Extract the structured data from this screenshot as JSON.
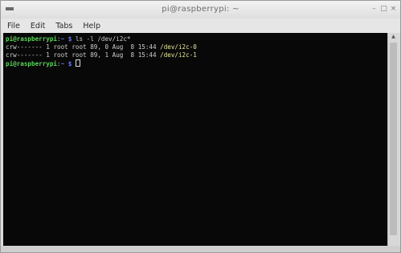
{
  "window": {
    "title": "pi@raspberrypi: ~",
    "controls": [
      "–",
      "□",
      "×"
    ]
  },
  "menu": {
    "items": [
      "File",
      "Edit",
      "Tabs",
      "Help"
    ]
  },
  "terminal": {
    "prompt_user": "pi@raspberrypi",
    "prompt_path": "~",
    "prompt_symbol": "$",
    "command": "ls -l /dev/i2c*",
    "lines": [
      {
        "perms": "crw-------",
        "links": "1",
        "owner": "root",
        "group": "root",
        "major": "89,",
        "minor": "0",
        "month": "Aug",
        "day": "8",
        "time": "15:44",
        "path": "/dev/i2c-0"
      },
      {
        "perms": "crw-------",
        "links": "1",
        "owner": "root",
        "group": "root",
        "major": "89,",
        "minor": "1",
        "month": "Aug",
        "day": "8",
        "time": "15:44",
        "path": "/dev/i2c-1"
      }
    ]
  },
  "colors": {
    "prompt_user": "#5bd65b",
    "prompt_path": "#6a7cff",
    "device_path": "#e8e8a0",
    "terminal_bg": "#080808"
  }
}
